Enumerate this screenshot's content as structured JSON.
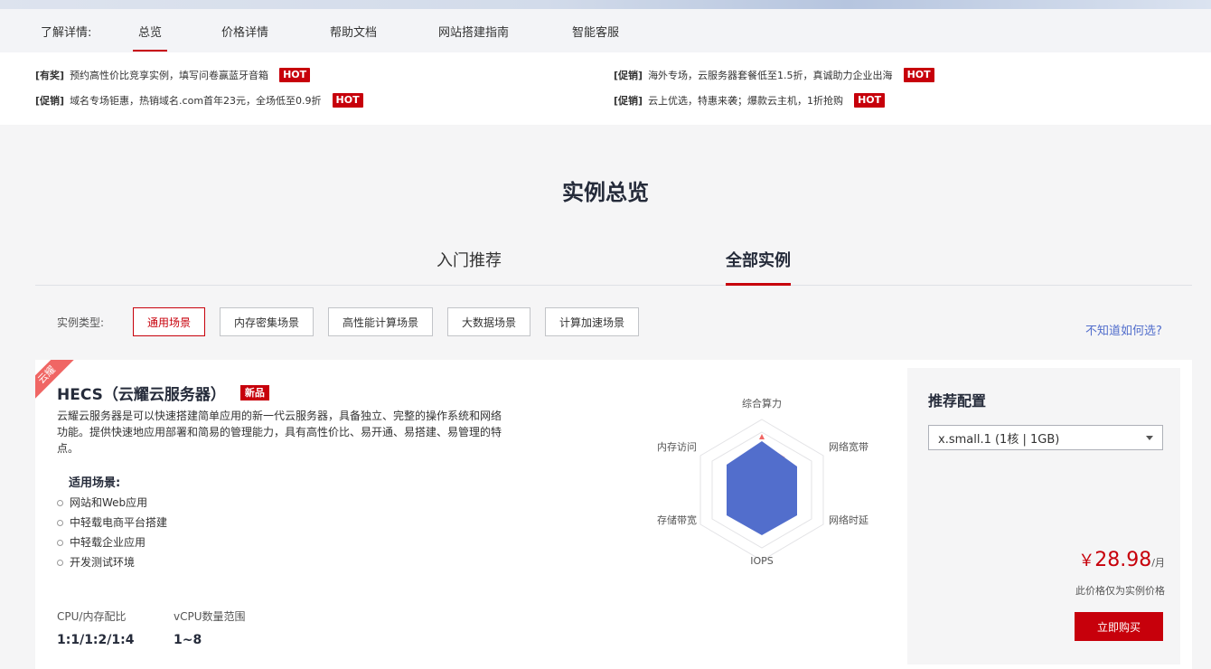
{
  "nav": {
    "label": "了解详情:",
    "items": [
      "总览",
      "价格详情",
      "帮助文档",
      "网站搭建指南",
      "智能客服"
    ]
  },
  "promos": [
    {
      "tag": "[有奖]",
      "text": "预约高性价比竞享实例，填写问卷赢蓝牙音箱",
      "hot": "HOT"
    },
    {
      "tag": "[促销]",
      "text": "海外专场，云服务器套餐低至1.5折，真诚助力企业出海",
      "hot": "HOT"
    },
    {
      "tag": "[促销]",
      "text": "域名专场钜惠，热销域名.com首年23元，全场低至0.9折",
      "hot": "HOT"
    },
    {
      "tag": "[促销]",
      "text": "云上优选，特惠来袭；爆款云主机，1折抢购",
      "hot": "HOT"
    }
  ],
  "section": {
    "title": "实例总览"
  },
  "tabs": [
    "入门推荐",
    "全部实例"
  ],
  "filter": {
    "label": "实例类型:",
    "options": [
      "通用场景",
      "内存密集场景",
      "高性能计算场景",
      "大数据场景",
      "计算加速场景"
    ],
    "help": "不知道如何选?"
  },
  "card": {
    "corner": "云耀",
    "title": "HECS（云耀云服务器）",
    "badge": "新品",
    "description": "云耀云服务器是可以快速搭建简单应用的新一代云服务器，具备独立、完整的操作系统和网络功能。提供快速地应用部署和简易的管理能力，具有高性价比、易开通、易搭建、易管理的特点。",
    "scene_title": "适用场景:",
    "scenes": [
      "网站和Web应用",
      "中轻载电商平台搭建",
      "中轻载企业应用",
      "开发测试环境"
    ],
    "specs": [
      {
        "key": "CPU/内存配比",
        "value": "1:1/1:2/1:4"
      },
      {
        "key": "vCPU数量范围",
        "value": "1~8"
      }
    ],
    "radar": {
      "axes": [
        "综合算力",
        "网络宽带",
        "网络时延",
        "IOPS",
        "存储带宽",
        "内存访问"
      ],
      "fill_color": "#526ecc",
      "highlight_color": "#f06664"
    }
  },
  "recommend": {
    "title": "推荐配置",
    "selected": "x.small.1 (1核 | 1GB)",
    "currency": "￥",
    "price": "28.98",
    "unit": "/月",
    "note": "此价格仅为实例价格",
    "buy": "立即购买"
  }
}
